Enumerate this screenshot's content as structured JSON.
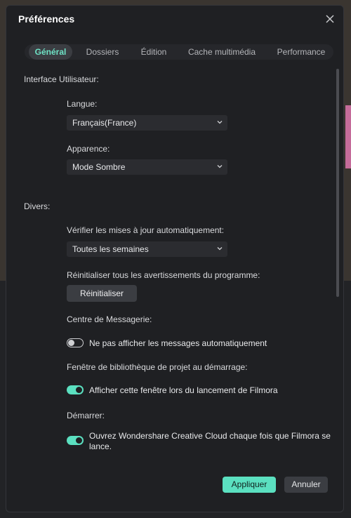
{
  "dialog": {
    "title": "Préférences"
  },
  "tabs": [
    {
      "label": "Général",
      "active": true
    },
    {
      "label": "Dossiers",
      "active": false
    },
    {
      "label": "Édition",
      "active": false
    },
    {
      "label": "Cache multimédia",
      "active": false
    },
    {
      "label": "Performance",
      "active": false
    }
  ],
  "ui_section": {
    "title": "Interface Utilisateur:",
    "language_label": "Langue:",
    "language_value": "Français(France)",
    "appearance_label": "Apparence:",
    "appearance_value": "Mode Sombre"
  },
  "misc_section": {
    "title": "Divers:",
    "updates_label": "Vérifier les mises à jour automatiquement:",
    "updates_value": "Toutes les semaines",
    "reset_warnings_label": "Réinitialiser tous les avertissements du programme:",
    "reset_button": "Réinitialiser",
    "message_center_label": "Centre de Messagerie:",
    "message_center_toggle_text": "Ne pas afficher les messages automatiquement",
    "message_center_toggle_on": false,
    "project_library_label": "Fenêtre de bibliothèque de projet au démarrage:",
    "project_library_toggle_text": "Afficher cette fenêtre lors du lancement de Filmora",
    "project_library_toggle_on": true,
    "startup_label": "Démarrer:",
    "startup_toggle_text": "Ouvrez Wondershare Creative Cloud chaque fois que Filmora se lance.",
    "startup_toggle_on": true
  },
  "footer": {
    "apply": "Appliquer",
    "cancel": "Annuler"
  },
  "colors": {
    "accent": "#5be0c0",
    "dialog_bg": "#1f2023"
  }
}
